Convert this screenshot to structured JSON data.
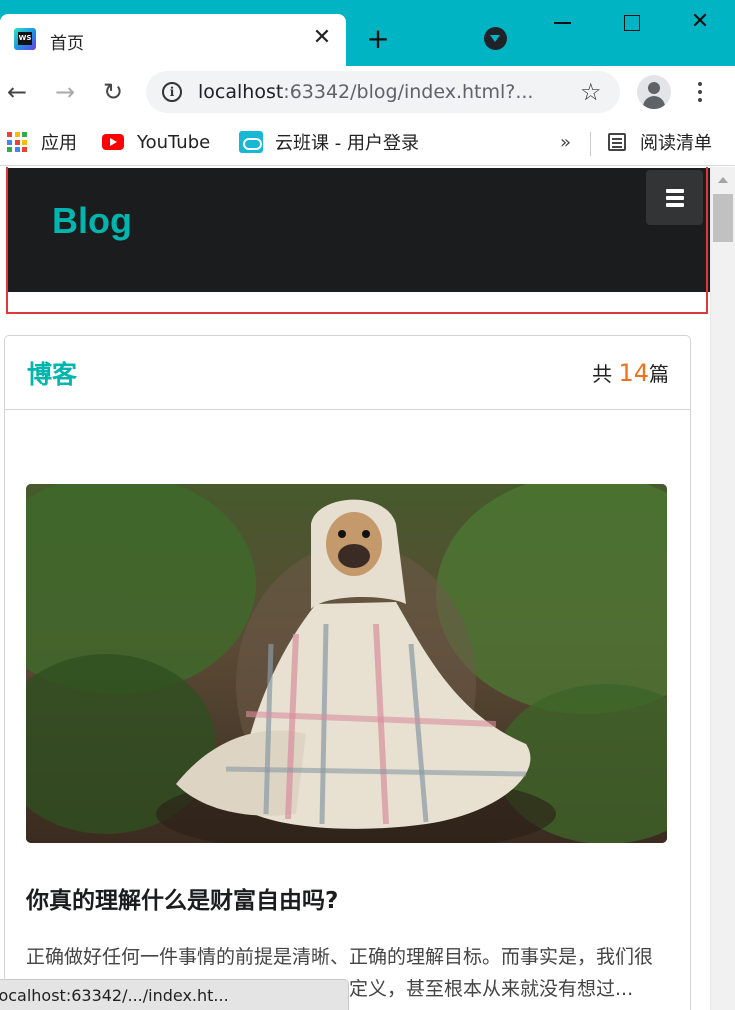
{
  "browser": {
    "tab": {
      "title": "首页",
      "favicon_text": "WS"
    },
    "address": {
      "host": "localhost",
      "path": ":63342/blog/index.html?..."
    },
    "bookmarks": [
      {
        "label": "应用",
        "icon": "apps-grid-icon"
      },
      {
        "label": "YouTube",
        "icon": "youtube-icon"
      },
      {
        "label": "云班课 - 用户登录",
        "icon": "cloud-class-icon"
      }
    ],
    "bookmarks_more": "»",
    "reading_list": "阅读清单",
    "status_url": "localhost:63342/.../index.ht...",
    "icons": {
      "back": "←",
      "forward": "→",
      "reload": "↻",
      "info": "i",
      "star": "☆",
      "close": "✕",
      "new_tab": "+",
      "window_close": "✕"
    }
  },
  "site": {
    "brand": "Blog",
    "accent_color": "#00b5ad",
    "count_color": "#f2711c",
    "highlight_color": "#e03838",
    "card": {
      "title": "博客",
      "count_prefix": "共 ",
      "count": "14",
      "count_suffix": "篇"
    },
    "post": {
      "title": "你真的理解什么是财富自由吗?",
      "excerpt": "正确做好任何一件事情的前提是清晰、正确的理解目标。而事实是，我们很多人很多时候根本没有对目标的正确的定义，甚至根本从来就没有想过...",
      "image": "pug-wrapped-in-blanket-in-forest"
    }
  }
}
